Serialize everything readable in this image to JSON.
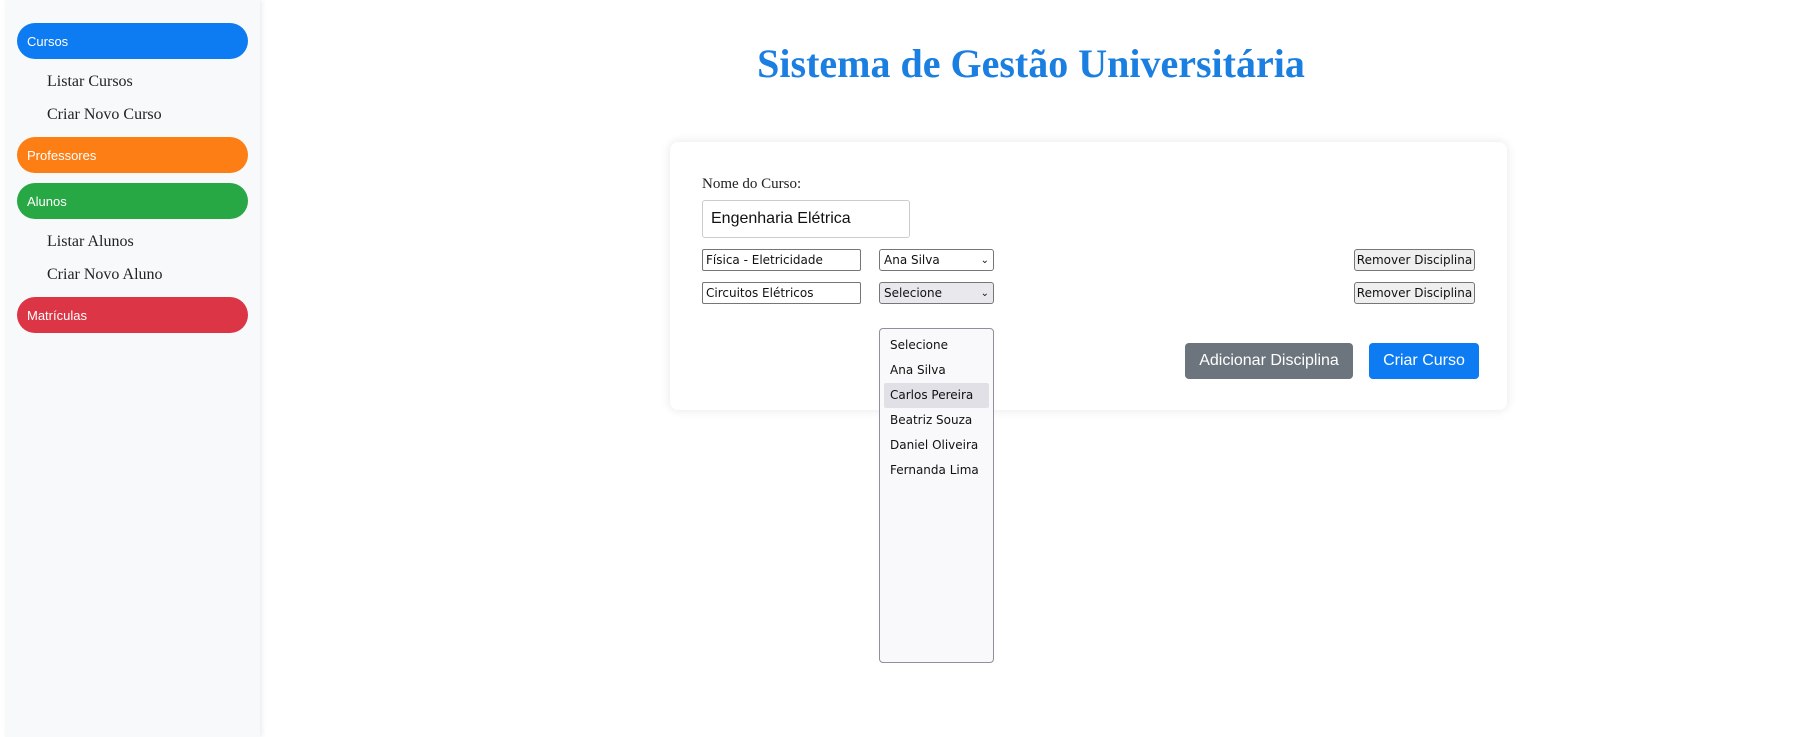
{
  "sidebar": {
    "sections": [
      {
        "label": "Cursos",
        "color": "#0d7bf2",
        "items": [
          "Listar Cursos",
          "Criar Novo Curso"
        ]
      },
      {
        "label": "Professores",
        "color": "#fd7e14",
        "items": []
      },
      {
        "label": "Alunos",
        "color": "#28a745",
        "items": [
          "Listar Alunos",
          "Criar Novo Aluno"
        ]
      },
      {
        "label": "Matrículas",
        "color": "#dc3545",
        "items": []
      }
    ]
  },
  "main": {
    "title": "Sistema de Gestão Universitária",
    "form": {
      "name_label": "Nome do Curso:",
      "name_value": "Engenharia Elétrica",
      "rows": [
        {
          "discipline": "Física - Eletricidade",
          "professor": "Ana Silva",
          "remove_label": "Remover Disciplina"
        },
        {
          "discipline": "Circuitos Elétricos",
          "professor": "Selecione",
          "remove_label": "Remover Disciplina"
        }
      ],
      "dropdown_options": [
        "Selecione",
        "Ana Silva",
        "Carlos Pereira",
        "Beatriz Souza",
        "Daniel Oliveira",
        "Fernanda Lima"
      ],
      "hovered_option": "Carlos Pereira",
      "add_button": "Adicionar Disciplina",
      "add_button_color": "#6c757d",
      "create_button": "Criar Curso",
      "create_button_color": "#0d7bf2"
    }
  }
}
